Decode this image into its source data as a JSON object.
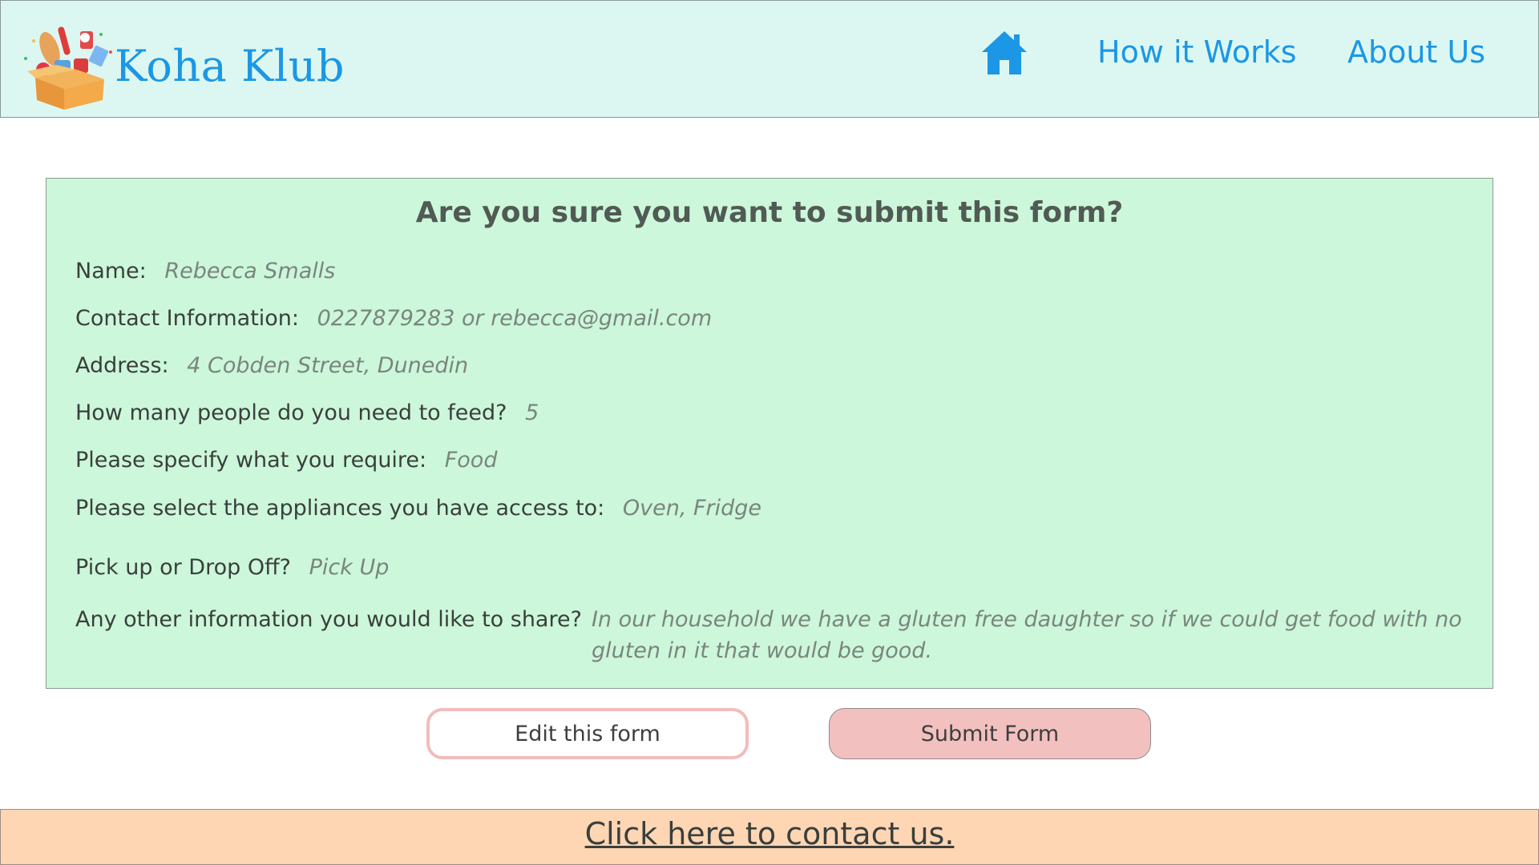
{
  "header": {
    "brand": "Koha Klub",
    "logo_icon": "food-box-logo-icon",
    "home_icon": "home-icon",
    "nav": {
      "how_it_works": "How it Works",
      "about_us": "About Us"
    }
  },
  "confirm": {
    "title": "Are you sure you want to submit this form?",
    "fields": {
      "name": {
        "label": "Name:",
        "value": "Rebecca Smalls"
      },
      "contact": {
        "label": "Contact Information:",
        "value": "0227879283 or rebecca@gmail.com"
      },
      "address": {
        "label": "Address:",
        "value": "4 Cobden Street, Dunedin"
      },
      "people": {
        "label": "How many people do you need to feed?",
        "value": "5"
      },
      "require": {
        "label": "Please specify what you require:",
        "value": "Food"
      },
      "appliances": {
        "label": "Please select the appliances you have access to:",
        "value": "Oven, Fridge"
      },
      "pickup": {
        "label": "Pick up or Drop Off?",
        "value": "Pick Up"
      },
      "other": {
        "label": "Any other information you would like to share?",
        "value": "In our household we have a gluten free daughter so if we could get food with no gluten in it that would be good."
      }
    }
  },
  "buttons": {
    "edit": "Edit this form",
    "submit": "Submit Form"
  },
  "footer": {
    "contact_link": "Click here to contact us."
  },
  "colors": {
    "header_bg": "#dcf7f1",
    "brand_blue": "#1b97e6",
    "card_bg": "#ccf7da",
    "button_pink": "#f3c0c0",
    "footer_bg": "#fed6b4"
  }
}
